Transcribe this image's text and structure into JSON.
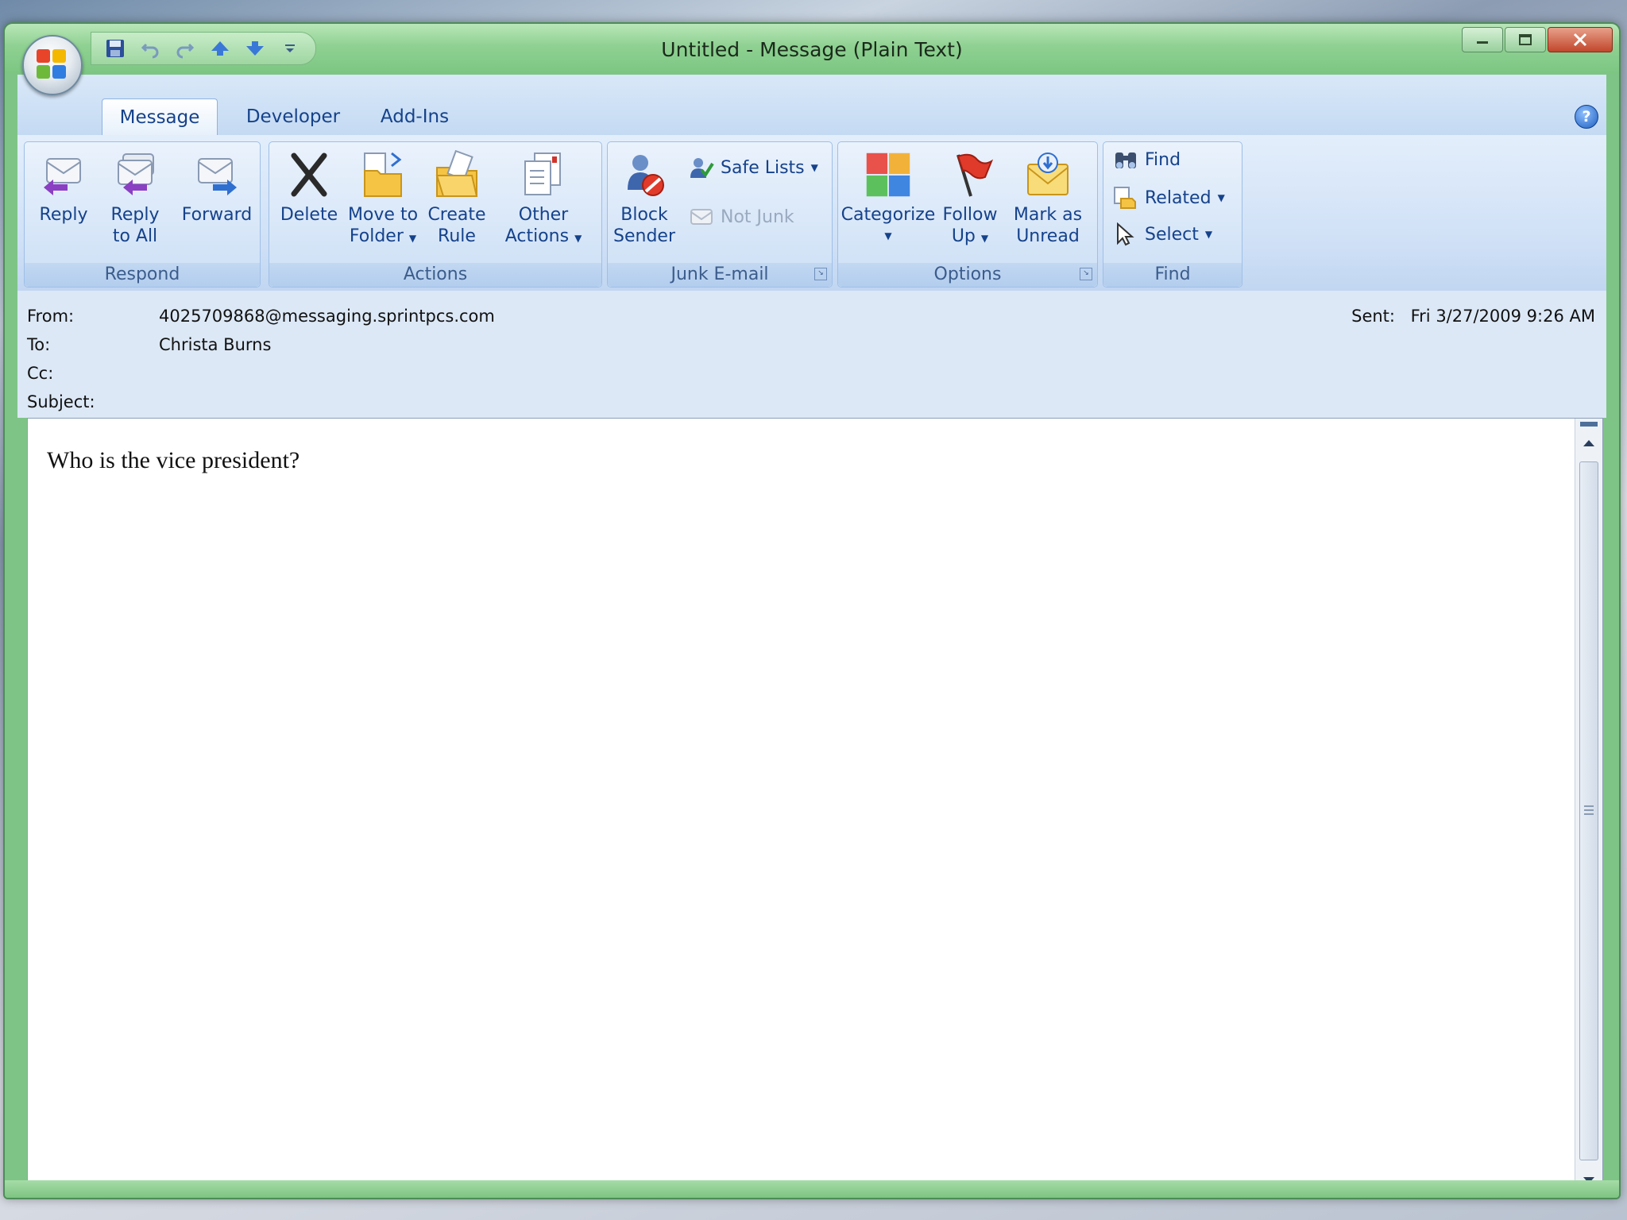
{
  "window": {
    "title": "Untitled - Message (Plain Text)"
  },
  "tabs": [
    {
      "label": "Message",
      "active": true
    },
    {
      "label": "Developer",
      "active": false
    },
    {
      "label": "Add-Ins",
      "active": false
    }
  ],
  "ribbon": {
    "respond": {
      "label": "Respond",
      "reply": "Reply",
      "reply_all_1": "Reply",
      "reply_all_2": "to All",
      "forward": "Forward"
    },
    "actions": {
      "label": "Actions",
      "delete": "Delete",
      "move_1": "Move to",
      "move_2": "Folder",
      "create_1": "Create",
      "create_2": "Rule",
      "other_1": "Other",
      "other_2": "Actions"
    },
    "junk": {
      "label": "Junk E-mail",
      "block_1": "Block",
      "block_2": "Sender",
      "safe_lists": "Safe Lists",
      "not_junk": "Not Junk"
    },
    "options": {
      "label": "Options",
      "categorize": "Categorize",
      "follow_1": "Follow",
      "follow_2": "Up",
      "mark_1": "Mark as",
      "mark_2": "Unread"
    },
    "find": {
      "label": "Find",
      "find": "Find",
      "related": "Related",
      "select": "Select"
    }
  },
  "header": {
    "from_label": "From:",
    "from_value": "4025709868@messaging.sprintpcs.com",
    "to_label": "To:",
    "to_value": "Christa Burns",
    "cc_label": "Cc:",
    "subject_label": "Subject:",
    "sent_label": "Sent:",
    "sent_value": "Fri 3/27/2009 9:26 AM"
  },
  "body": {
    "text": "Who is the vice president?"
  },
  "colors": {
    "accent": "#15428b",
    "title_bar": "#8fd192",
    "ribbon": "#cfe0f6"
  }
}
